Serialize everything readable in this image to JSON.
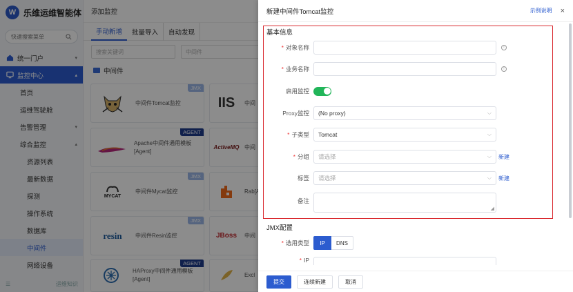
{
  "app": {
    "logo_letter": "W",
    "name": "乐维运维智能体"
  },
  "sidebar": {
    "search_placeholder": "快速搜索菜单",
    "items": [
      {
        "label": "统一门户"
      },
      {
        "label": "监控中心"
      }
    ],
    "sub_items": [
      "首页",
      "运维驾驶舱",
      "告警管理",
      "综合监控"
    ],
    "sub_sub_items": [
      "资源列表",
      "最新数据",
      "探测",
      "操作系统",
      "数据库",
      "中间件",
      "网络设备"
    ],
    "footer_label": "运维知识"
  },
  "main": {
    "title": "添加监控",
    "tabs": [
      "手动新增",
      "批量导入",
      "自动发现"
    ],
    "filter_placeholder": "搜索关键词",
    "filter_category": "中间件",
    "section": "中间件",
    "cards": [
      {
        "name": "中间件Tomcat监控",
        "badge": "JMX"
      },
      {
        "name": "Apache中间件通用模板[Agent]",
        "badge": "AGENT"
      },
      {
        "name": "中间件Mycat监控",
        "badge": "JMX"
      },
      {
        "name": "中间件Resin监控",
        "badge": "JMX"
      },
      {
        "name": "HAProxy中间件通用模板[Agent]",
        "badge": "AGENT"
      }
    ],
    "cards_right": [
      {
        "logo": "IIS",
        "name": "中间"
      },
      {
        "logo": "ActiveMQ",
        "name": "中间"
      },
      {
        "logo": "",
        "name": "Rab[Ag"
      },
      {
        "logo": "JBoss",
        "name": "中间"
      },
      {
        "logo": "",
        "name": "Excl"
      }
    ],
    "logos": {
      "mycat": "MYCAT",
      "resin": "resin"
    }
  },
  "drawer": {
    "title": "新建中间件Tomcat监控",
    "help_link": "示例说明",
    "close": "×",
    "basic_info": "基本信息",
    "fields": {
      "object_name": "对象名称",
      "business_name": "业务名称",
      "enable_monitor": "启用监控",
      "proxy_monitor": "Proxy监控",
      "proxy_value": "(No proxy)",
      "sub_type": "子类型",
      "sub_type_value": "Tomcat",
      "group": "分组",
      "group_placeholder": "请选择",
      "tag": "标签",
      "tag_placeholder": "请选择",
      "remark": "备注",
      "new_link": "新建"
    },
    "jmx_section": "JMX配置",
    "jmx": {
      "select_type": "选用类型",
      "opt_ip": "IP",
      "opt_dns": "DNS",
      "ip_label": "IP"
    },
    "footer": {
      "submit": "提交",
      "continue": "连续新建",
      "cancel": "取消"
    }
  }
}
